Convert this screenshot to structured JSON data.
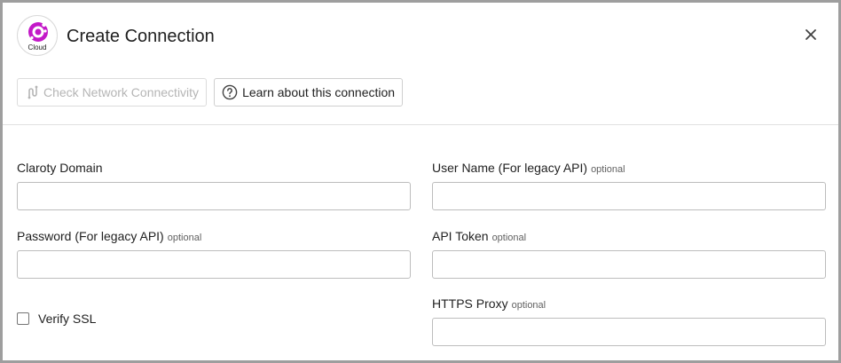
{
  "dialog": {
    "title": "Create Connection",
    "logo_label": "Cloud",
    "brand_color": "#c318c8"
  },
  "toolbar": {
    "check_network_label": "Check Network Connectivity",
    "learn_label": "Learn about this connection"
  },
  "fields": {
    "claroty_domain": {
      "label": "Claroty Domain",
      "value": ""
    },
    "user_name": {
      "label": "User Name (For legacy API)",
      "optional": "optional",
      "value": ""
    },
    "password": {
      "label": "Password (For legacy API)",
      "optional": "optional",
      "value": ""
    },
    "api_token": {
      "label": "API Token",
      "optional": "optional",
      "value": ""
    },
    "https_proxy": {
      "label": "HTTPS Proxy",
      "optional": "optional",
      "value": ""
    }
  },
  "verify_ssl": {
    "label": "Verify SSL",
    "checked": false
  }
}
